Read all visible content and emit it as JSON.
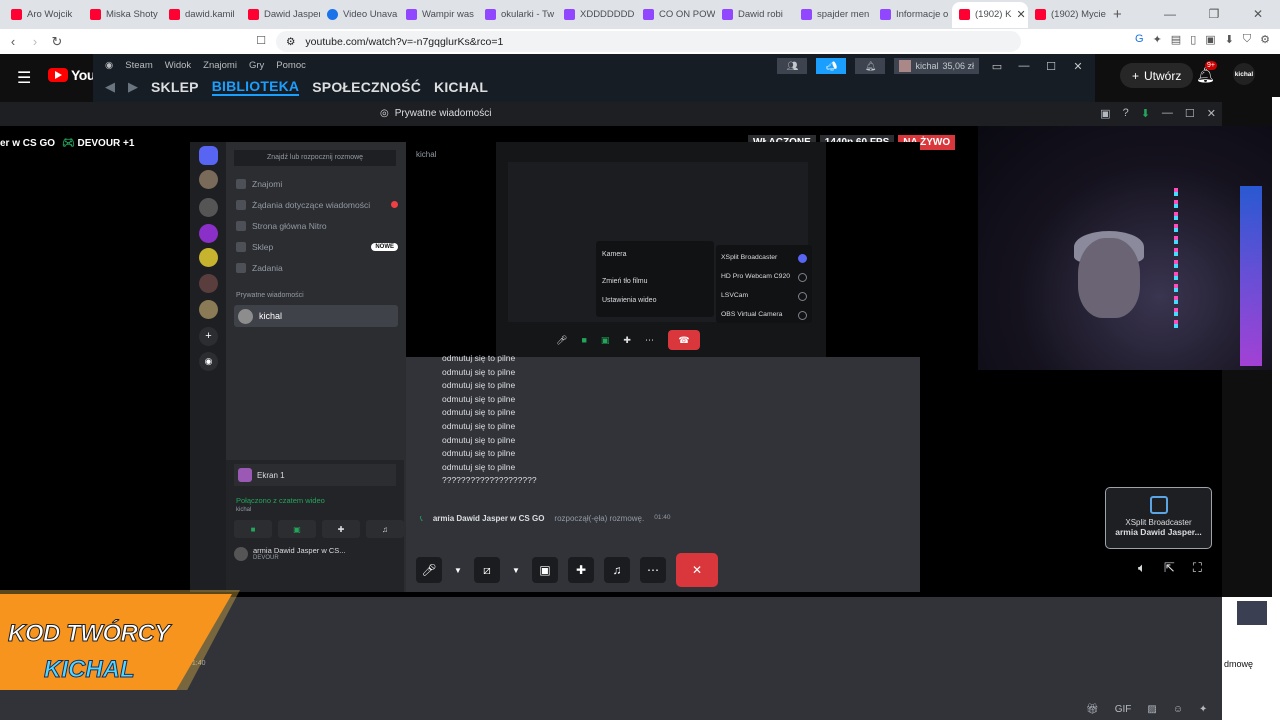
{
  "browser": {
    "tabs": [
      {
        "label": "Aro Wojcik",
        "color": "#ff0033"
      },
      {
        "label": "Miska Shoty",
        "color": "#ff0033"
      },
      {
        "label": "dawid.kamil",
        "color": "#ff0033"
      },
      {
        "label": "Dawid Jasper",
        "color": "#ff0033"
      },
      {
        "label": "Video Unava",
        "color": "#1a73e8"
      },
      {
        "label": "Wampir was",
        "color": "#9146ff"
      },
      {
        "label": "okularki - Tw",
        "color": "#9146ff"
      },
      {
        "label": "XDDDDDDD",
        "color": "#9146ff"
      },
      {
        "label": "CO ON POW",
        "color": "#9146ff"
      },
      {
        "label": "Dawid robi",
        "color": "#9146ff"
      },
      {
        "label": "spajder men",
        "color": "#9146ff"
      },
      {
        "label": "Informacje o",
        "color": "#9146ff"
      },
      {
        "label": "(1902) K",
        "color": "#ff0033"
      },
      {
        "label": "(1902) Mycie",
        "color": "#ff0033"
      }
    ],
    "url": "youtube.com/watch?v=-n7gqglurKs&rco=1"
  },
  "youtube": {
    "logo_text": "YouTu",
    "create_label": "Utwórz",
    "notif_badge": "9+",
    "avatar_text": "kichal"
  },
  "steam": {
    "menu": [
      "Steam",
      "Widok",
      "Znajomi",
      "Gry",
      "Pomoc"
    ],
    "nav": [
      "SKLEP",
      "BIBLIOTEKA",
      "SPOŁECZNOŚĆ",
      "KICHAL"
    ],
    "username": "kichal",
    "balance": "35,06 zł"
  },
  "discord_window": {
    "title": "Prywatne wiadomości"
  },
  "stream": {
    "title_fragment": "er w CS GO",
    "follow_text": "DEVOUR +1",
    "badges": {
      "on": "WŁĄCZONE",
      "quality": "1440p 60 FPS",
      "live": "NA ŻYWO"
    }
  },
  "inner": {
    "search_placeholder": "Znajdź lub rozpocznij rozmowę",
    "rows": [
      {
        "label": "Znajomi"
      },
      {
        "label": "Żądania dotyczące wiadomości"
      },
      {
        "label": "Strona główna Nitro"
      },
      {
        "label": "Sklep",
        "badge": "NOWE"
      },
      {
        "label": "Zadania"
      }
    ],
    "dm_section": "Prywatne wiadomości",
    "dm_user": "kichal",
    "chat_header": "kichal",
    "voice": {
      "ekran": "Ekran 1",
      "connected": "Połączono z czatem wideo",
      "connected_sub": "kichal",
      "user": "armia Dawid Jasper w CS...",
      "user_status": "DEVOUR"
    },
    "context_menu": [
      "Kamera",
      "Zmień tło filmu",
      "Ustawienia wideo"
    ],
    "camera_sub": "XSplit Broadcaster",
    "camera_options": [
      "XSplit Broadcaster",
      "HD Pro Webcam C920",
      "LSVCam",
      "OBS Virtual Camera"
    ],
    "mini_tile": "armia Dawid Jasper...",
    "messages": [
      "odmutuj się to pilne",
      "odmutuj się to pilne",
      "odmutuj się to pilne",
      "odmutuj się to pilne",
      "odmutuj się to pilne",
      "odmutuj się to pilne",
      "odmutuj się to pilne",
      "odmutuj się to pilne",
      "odmutuj się to pilne",
      "????????????????????"
    ],
    "system_user": "armia Dawid Jasper w CS GO",
    "system_text": "rozpoczął(-ęła) rozmowę.",
    "system_time": "01:40"
  },
  "xsplit_tile": {
    "app": "XSplit Broadcaster",
    "name": "armia Dawid Jasper..."
  },
  "promo": {
    "line1": "KOD TWÓRCY",
    "line2": "KICHAL"
  },
  "bottom": {
    "sliver": "pilne",
    "time": "01:40",
    "side_text": "dmowę"
  }
}
